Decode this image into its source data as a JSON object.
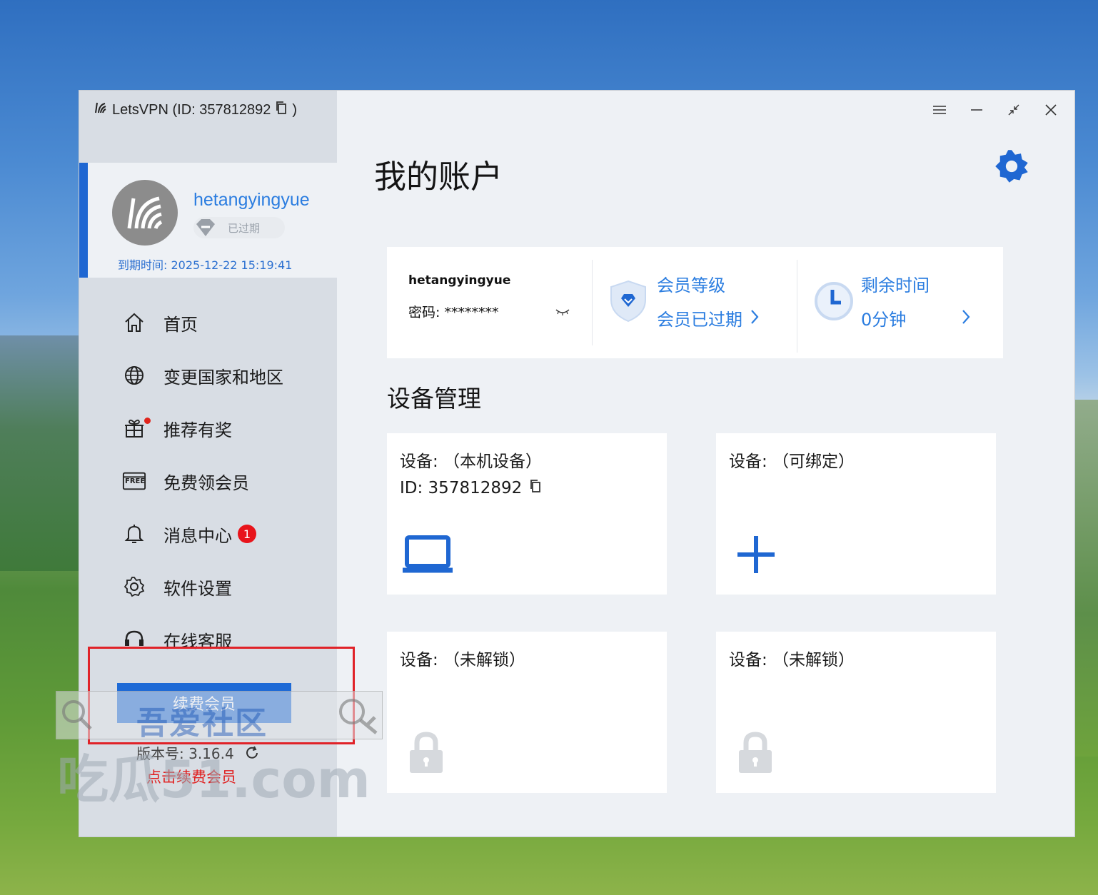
{
  "window": {
    "title": "LetsVPN (ID:  357812892",
    "title_close": ")"
  },
  "profile": {
    "username": "hetangyingyue",
    "status_badge": "已过期",
    "expire_label": "到期时间: 2025-12-22 15:19:41"
  },
  "nav": {
    "items": [
      {
        "label": "首页",
        "icon": "home-icon"
      },
      {
        "label": "变更国家和地区",
        "icon": "globe-icon"
      },
      {
        "label": "推荐有奖",
        "icon": "gift-icon"
      },
      {
        "label": "免费领会员",
        "icon": "free-icon"
      },
      {
        "label": "消息中心",
        "icon": "bell-icon",
        "badge": "1"
      },
      {
        "label": "软件设置",
        "icon": "gear-icon"
      },
      {
        "label": "在线客服",
        "icon": "headset-icon"
      }
    ],
    "free_icon_text": "FREE"
  },
  "sidebar_footer": {
    "renew_button": "续费会员",
    "version": "版本号:  3.16.4",
    "renew_hint": "点击续费会员"
  },
  "watermark": {
    "title": "吾爱社区",
    "url": "吃瓜51.com"
  },
  "main": {
    "page_title": "我的账户",
    "account": {
      "username": "hetangyingyue",
      "password_label": "密码: ********",
      "member_level_label": "会员等级",
      "member_level_value": "会员已过期",
      "remaining_label": "剩余时间",
      "remaining_value": "0分钟"
    },
    "devices_title": "设备管理",
    "devices": [
      {
        "title": "设备:  （本机设备）",
        "id": "ID: 357812892",
        "icon": "laptop-icon"
      },
      {
        "title": "设备:  （可绑定）",
        "icon": "plus-icon"
      },
      {
        "title": "设备:  （未解锁）",
        "icon": "lock-icon"
      },
      {
        "title": "设备:  （未解锁）",
        "icon": "lock-icon"
      }
    ]
  },
  "colors": {
    "accent": "#1f67d2",
    "link_blue": "#2b7de0",
    "alert_red": "#e02228"
  }
}
